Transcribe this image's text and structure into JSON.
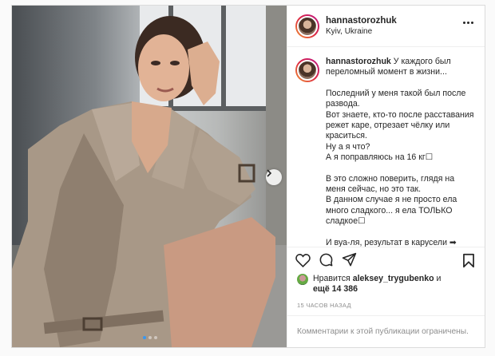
{
  "post": {
    "username": "hannastorozhuk",
    "location": "Kyiv, Ukraine",
    "caption_lines": [
      "У каждого был переломный момент в жизни...",
      "",
      "Последний у меня такой был после развода.",
      "Вот знаете, кто-то после расставания режет каре, отрезает чёлку или краситься.",
      "Ну а я что?",
      "А я поправляюсь на 16 кг☐",
      "",
      "В это сложно поверить, глядя на меня сейчас, но это так.",
      "В данном случае я не просто ела много сладкого... я ела ТОЛЬКО сладкое☐",
      "",
      "И вуа-ля, результат в карусели ➡"
    ],
    "likes_prefix": "Нравится ",
    "liked_by": "aleksey_trygubenko",
    "likes_conj": " и",
    "likes_more": "ещё 14 386",
    "timestamp": "15 ЧАСОВ НАЗАД",
    "comments_disabled": "Комментарии к этой публикации ограничены."
  },
  "carousel": {
    "slides": 3,
    "active": 1
  },
  "icons": [
    "more-icon",
    "heart-icon",
    "comment-icon",
    "share-icon",
    "bookmark-icon",
    "chevron-right-icon"
  ],
  "colors": {
    "story_ring": [
      "#f09433",
      "#dc2743",
      "#bc1888"
    ],
    "active_dot": "#3897f0",
    "muted": "#8e8e8e"
  }
}
